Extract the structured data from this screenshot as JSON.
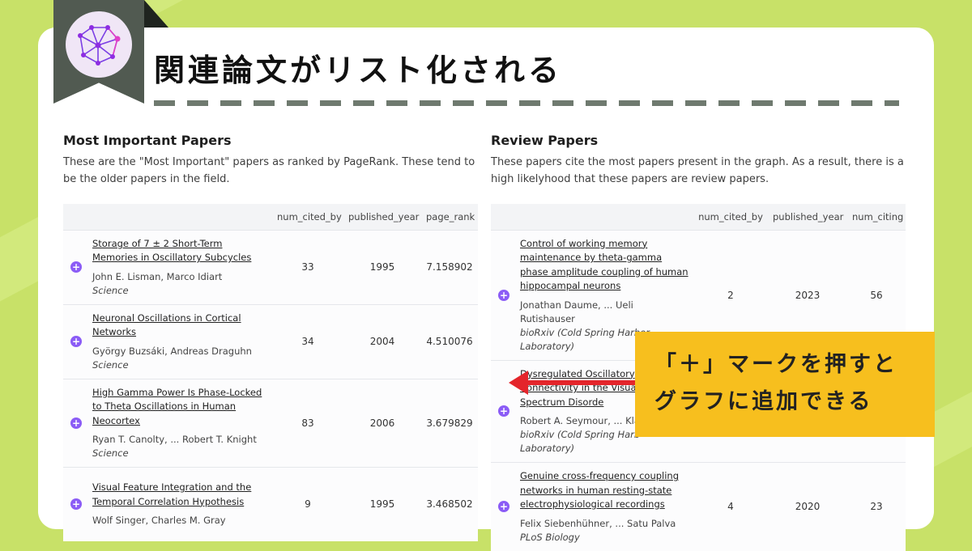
{
  "header": {
    "title": "関連論文がリスト化される"
  },
  "callout": {
    "line1": "「＋」マークを押すと",
    "line2": "グラフに追加できる"
  },
  "colors": {
    "background": "#c8e168",
    "accent": "#8b5cf6",
    "callout": "#f7bf1e",
    "arrow": "#e4252b",
    "ribbon": "#515a51"
  },
  "icons": {
    "add": "plus-circle-icon",
    "logo": "network-graph-logo"
  },
  "left_panel": {
    "heading": "Most Important Papers",
    "description": "These are the \"Most Important\" papers as ranked by PageRank. These tend to be the older papers in the field.",
    "columns": [
      "num_cited_by",
      "published_year",
      "page_rank"
    ],
    "rows": [
      {
        "title": "Storage of 7 ± 2 Short-Term Memories in Oscillatory Subcycles",
        "authors": "John E. Lisman, Marco Idiart",
        "journal": "Science",
        "c1": "33",
        "c2": "1995",
        "c3": "7.158902"
      },
      {
        "title": "Neuronal Oscillations in Cortical Networks",
        "authors": "György Buzsáki, Andreas Draguhn",
        "journal": "Science",
        "c1": "34",
        "c2": "2004",
        "c3": "4.510076"
      },
      {
        "title": "High Gamma Power Is Phase-Locked to Theta Oscillations in Human Neocortex",
        "authors": "Ryan T. Canolty, ... Robert T. Knight",
        "journal": "Science",
        "c1": "83",
        "c2": "2006",
        "c3": "3.679829"
      },
      {
        "title": "Visual Feature Integration and the Temporal Correlation Hypothesis",
        "authors": "Wolf Singer, Charles M. Gray",
        "journal": "",
        "c1": "9",
        "c2": "1995",
        "c3": "3.468502"
      }
    ]
  },
  "right_panel": {
    "heading": "Review Papers",
    "description": "These papers cite the most papers present in the graph. As a result, there is a high likelyhood that these papers are review papers.",
    "columns": [
      "num_cited_by",
      "published_year",
      "num_citing"
    ],
    "rows": [
      {
        "title": "Control of working memory maintenance by theta-gamma phase amplitude coupling of human hippocampal neurons",
        "authors": "Jonathan Daume, ... Ueli Rutishauser",
        "journal": "bioRxiv (Cold Spring Harbor Laboratory)",
        "c1": "2",
        "c2": "2023",
        "c3": "56"
      },
      {
        "title": "Dysregulated Oscillatory Connectivity in the Visual Autism Spectrum Disorde",
        "authors": "Robert A. Seymour, ... Klau",
        "journal": "bioRxiv (Cold Spring Harb Laboratory)",
        "c1": "",
        "c2": "",
        "c3": ""
      },
      {
        "title": "Genuine cross-frequency coupling networks in human resting-state electrophysiological recordings",
        "authors": "Felix Siebenhühner, ... Satu Palva",
        "journal": "PLoS Biology",
        "c1": "4",
        "c2": "2020",
        "c3": "23"
      }
    ]
  }
}
